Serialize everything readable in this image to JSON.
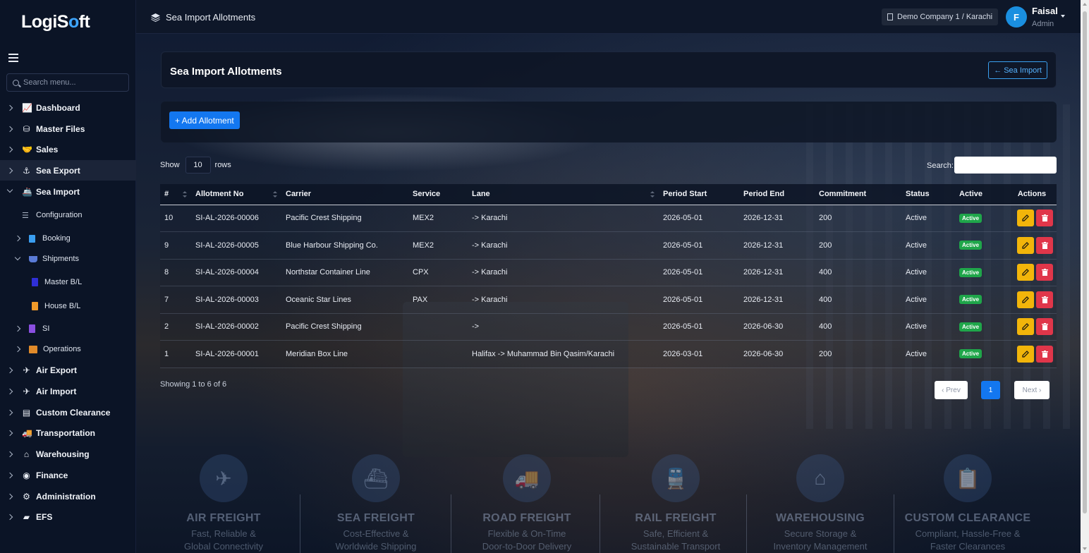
{
  "app": {
    "logo_main": "LogiS",
    "logo_o": "o",
    "logo_tail": "ft"
  },
  "sidebar": {
    "search_placeholder": "Search menu...",
    "items": [
      {
        "label": "Dashboard"
      },
      {
        "label": "Master Files"
      },
      {
        "label": "Sales"
      },
      {
        "label": "Sea Export"
      },
      {
        "label": "Sea Import"
      },
      {
        "label": "Air Export"
      },
      {
        "label": "Air Import"
      },
      {
        "label": "Custom Clearance"
      },
      {
        "label": "Transportation"
      },
      {
        "label": "Warehousing"
      },
      {
        "label": "Finance"
      },
      {
        "label": "Administration"
      },
      {
        "label": "EFS"
      }
    ],
    "sub": {
      "configuration": "Configuration",
      "booking": "Booking",
      "shipments": "Shipments",
      "master_bl": "Master B/L",
      "house_bl": "House B/L",
      "si": "SI",
      "operations": "Operations"
    }
  },
  "topbar": {
    "title": "Sea Import Allotments",
    "company": "Demo Company 1 / Karachi",
    "avatar_initial": "F",
    "user_name": "Faisal",
    "user_role": "Admin"
  },
  "page": {
    "title": "Sea Import Allotments",
    "back_button": "Sea Import",
    "add_button": "+ Add Allotment",
    "show_label": "Show",
    "rows_value": "10",
    "rows_label": "rows",
    "search_label": "Search:",
    "info": "Showing 1 to 6 of 6",
    "prev": "‹ Prev",
    "current_page": "1",
    "next": "Next ›"
  },
  "table": {
    "headers": [
      "#",
      "Allotment No",
      "Carrier",
      "Service",
      "Lane",
      "Period Start",
      "Period End",
      "Commitment",
      "Status",
      "Active",
      "Actions"
    ],
    "rows": [
      {
        "id": "10",
        "no": "SI-AL-2026-00006",
        "carrier": "Pacific Crest Shipping",
        "service": "MEX2",
        "lane": "-> Karachi",
        "start": "2026-05-01",
        "end": "2026-12-31",
        "commitment": "200",
        "status": "Active",
        "active": "Active"
      },
      {
        "id": "9",
        "no": "SI-AL-2026-00005",
        "carrier": "Blue Harbour Shipping Co.",
        "service": "MEX2",
        "lane": "-> Karachi",
        "start": "2026-05-01",
        "end": "2026-12-31",
        "commitment": "200",
        "status": "Active",
        "active": "Active"
      },
      {
        "id": "8",
        "no": "SI-AL-2026-00004",
        "carrier": "Northstar Container Line",
        "service": "CPX",
        "lane": "-> Karachi",
        "start": "2026-05-01",
        "end": "2026-12-31",
        "commitment": "400",
        "status": "Active",
        "active": "Active"
      },
      {
        "id": "7",
        "no": "SI-AL-2026-00003",
        "carrier": "Oceanic Star Lines",
        "service": "PAX",
        "lane": "-> Karachi",
        "start": "2026-05-01",
        "end": "2026-12-31",
        "commitment": "400",
        "status": "Active",
        "active": "Active"
      },
      {
        "id": "2",
        "no": "SI-AL-2026-00002",
        "carrier": "Pacific Crest Shipping",
        "service": "",
        "lane": "->",
        "start": "2026-05-01",
        "end": "2026-06-30",
        "commitment": "400",
        "status": "Active",
        "active": "Active"
      },
      {
        "id": "1",
        "no": "SI-AL-2026-00001",
        "carrier": "Meridian Box Line",
        "service": "",
        "lane": "Halifax -> Muhammad Bin Qasim/Karachi",
        "start": "2026-03-01",
        "end": "2026-06-30",
        "commitment": "200",
        "status": "Active",
        "active": "Active"
      }
    ]
  },
  "features": [
    {
      "title": "AIR FREIGHT",
      "l1": "Fast, Reliable &",
      "l2": "Global Connectivity"
    },
    {
      "title": "SEA FREIGHT",
      "l1": "Cost-Effective &",
      "l2": "Worldwide Shipping"
    },
    {
      "title": "ROAD FREIGHT",
      "l1": "Flexible & On-Time",
      "l2": "Door-to-Door Delivery"
    },
    {
      "title": "RAIL FREIGHT",
      "l1": "Safe, Efficient &",
      "l2": "Sustainable Transport"
    },
    {
      "title": "WAREHOUSING",
      "l1": "Secure Storage &",
      "l2": "Inventory Management"
    },
    {
      "title": "CUSTOM CLEARANCE",
      "l1": "Compliant, Hassle-Free &",
      "l2": "Faster Clearances"
    }
  ],
  "colors": {
    "accent": "#1377f0",
    "edit": "#f2b50a",
    "delete": "#e0364a",
    "active_badge": "#1fa64a"
  }
}
